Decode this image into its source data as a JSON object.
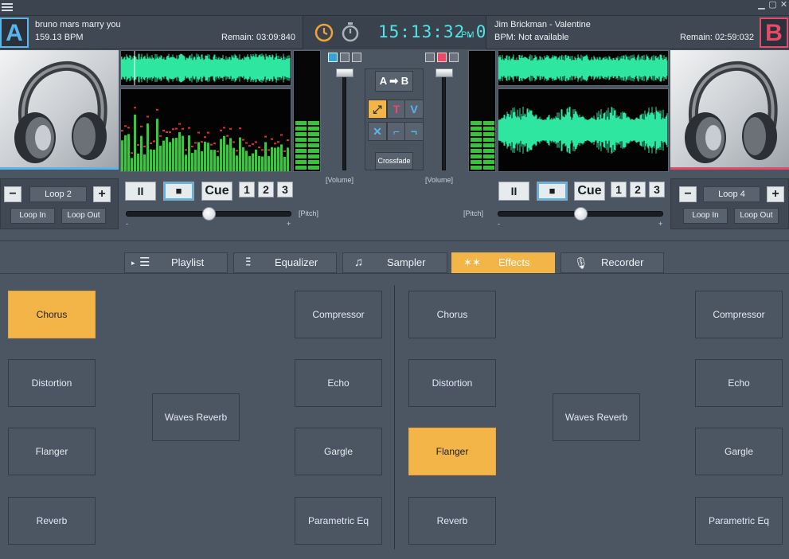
{
  "deck_a": {
    "badge": "A",
    "title": "bruno mars marry you",
    "bpm": "159.13 BPM",
    "remain": "Remain: 03:09:840",
    "loop": {
      "minus": "−",
      "name": "Loop 2",
      "plus": "+",
      "loop_in": "Loop In",
      "loop_out": "Loop Out"
    },
    "controls": {
      "pause": "II",
      "stop": "■",
      "cue": "Cue",
      "hot1": "1",
      "hot2": "2",
      "hot3": "3"
    },
    "pitch": {
      "label": "[Pitch]",
      "minus": "-",
      "plus": "+",
      "value": 0.5
    },
    "volume": {
      "label": "[Volume]",
      "value": 0.95
    }
  },
  "deck_b": {
    "badge": "B",
    "title": "Jim Brickman - Valentine",
    "bpm": "BPM: Not available",
    "remain": "Remain: 02:59:032",
    "loop": {
      "minus": "−",
      "name": "Loop 4",
      "plus": "+",
      "loop_in": "Loop In",
      "loop_out": "Loop Out"
    },
    "controls": {
      "pause": "II",
      "stop": "■",
      "cue": "Cue",
      "hot1": "1",
      "hot2": "2",
      "hot3": "3"
    },
    "pitch": {
      "label": "[Pitch]",
      "minus": "-",
      "plus": "+",
      "value": 0.5
    },
    "volume": {
      "label": "[Volume]",
      "value": 0.95
    }
  },
  "clock": {
    "time": "15:13:32.0",
    "ampm": "PM"
  },
  "mixer": {
    "ab_label": "A ➡ B",
    "crossfade_label": "Crossfade"
  },
  "tabs": [
    {
      "label": "Playlist",
      "icon": "list-icon"
    },
    {
      "label": "Equalizer",
      "icon": "equalizer-icon"
    },
    {
      "label": "Sampler",
      "icon": "music-note-icon"
    },
    {
      "label": "Effects",
      "icon": "stars-icon",
      "active": true
    },
    {
      "label": "Recorder",
      "icon": "microphone-icon"
    }
  ],
  "effects_a": {
    "chorus": "Chorus",
    "compressor": "Compressor",
    "distortion": "Distortion",
    "echo": "Echo",
    "waves_reverb": "Waves Reverb",
    "flanger": "Flanger",
    "gargle": "Gargle",
    "reverb": "Reverb",
    "parametric_eq": "Parametric Eq",
    "active": "Chorus"
  },
  "effects_b": {
    "chorus": "Chorus",
    "compressor": "Compressor",
    "distortion": "Distortion",
    "echo": "Echo",
    "waves_reverb": "Waves Reverb",
    "flanger": "Flanger",
    "gargle": "Gargle",
    "reverb": "Reverb",
    "parametric_eq": "Parametric Eq",
    "active": "Flanger"
  },
  "colors": {
    "accent_a": "#59b5ea",
    "accent_b": "#e84a6a",
    "active_effect": "#f3b548",
    "waveform": "#2ee6a0",
    "clock": "#4fe6ea"
  }
}
